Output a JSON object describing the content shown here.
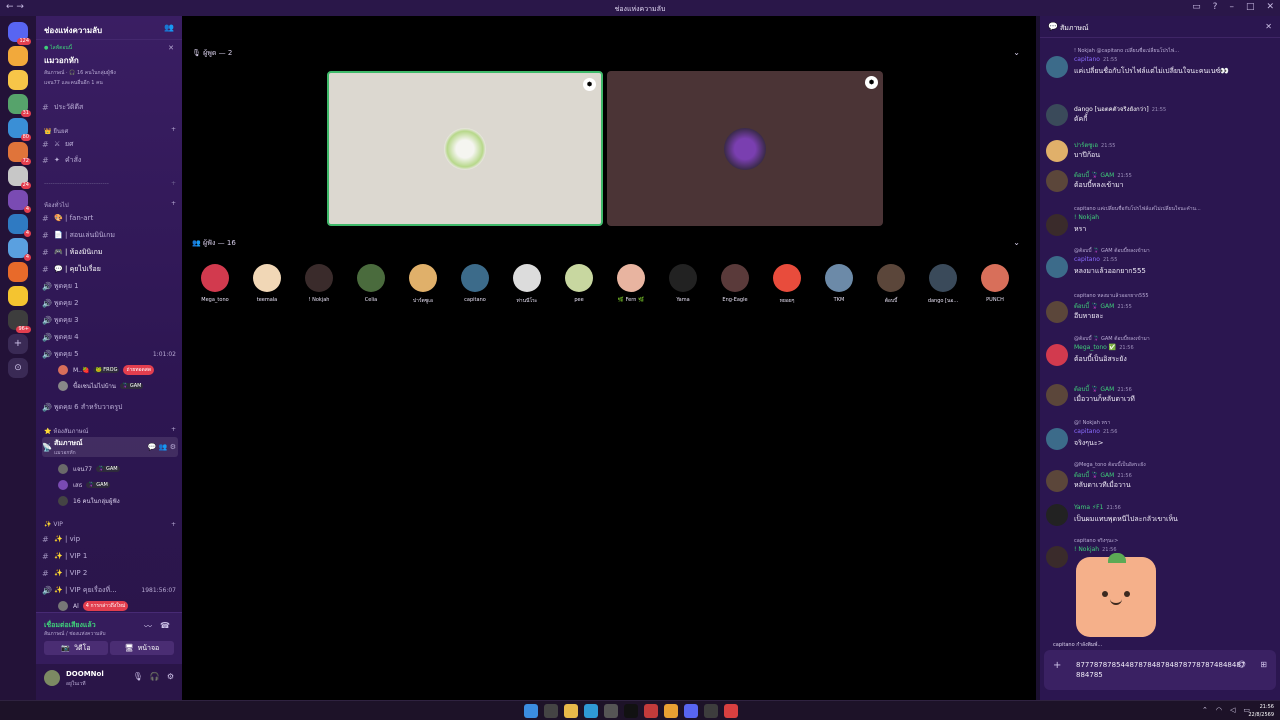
{
  "window": {
    "title": "ช่องแห่งความลับ"
  },
  "servers": [
    {
      "color": "#5865f2",
      "badge": "124"
    },
    {
      "color": "#f2a93b",
      "badge": ""
    },
    {
      "color": "#f7c548",
      "badge": ""
    },
    {
      "color": "#56a36b",
      "badge": "31"
    },
    {
      "color": "#3a8fd6",
      "badge": "80"
    },
    {
      "color": "#e0743a",
      "badge": "72"
    },
    {
      "color": "#c7c7c7",
      "badge": "24"
    },
    {
      "color": "#7a4bb3",
      "badge": "4"
    },
    {
      "color": "#2f7ac2",
      "badge": "4"
    },
    {
      "color": "#5aa0e0",
      "badge": "4"
    },
    {
      "color": "#e86a2a",
      "badge": ""
    },
    {
      "color": "#f4c430",
      "badge": ""
    },
    {
      "color": "#3d3d3d",
      "badge": "96+"
    }
  ],
  "sidebar": {
    "server_name": "ช่องแห่งความลับ",
    "event": {
      "live": "● ไลฟ์ตอนนี้",
      "title": "แมวอกหัก",
      "line1": "สัมภาษณ์ · 🎧 16 คนในกลุ่มผู้ฟัง",
      "line2": "แจน77 และคนอื่นอีก 1 คน"
    },
    "top_channels": [
      {
        "name": "ประวัติดีส",
        "emoji": ""
      },
      {
        "name": "ยศ",
        "emoji": "⚔"
      },
      {
        "name": "คำสั่ง",
        "emoji": "✦"
      }
    ],
    "cat_rank": "👑 ยืนยศ",
    "divider": "------------------------------",
    "cat_general": "ห้องทั่วไป",
    "general_channels": [
      {
        "name": "| fan-art",
        "emoji": "🎨"
      },
      {
        "name": "| สอนเล่นมินิเกม",
        "emoji": "📄"
      },
      {
        "name": "| ห้องมินิเกม",
        "emoji": "🎮"
      },
      {
        "name": "| คุยไปเรื่อย",
        "emoji": "💬"
      }
    ],
    "voice_channels": [
      "พูดคุย 1",
      "พูดคุย 2",
      "พูดคุย 3",
      "พูดคุย 4",
      "พูดคุย 5"
    ],
    "voice5_timer": "1:01:02",
    "voice5_users": [
      {
        "name": "M..🍓",
        "tag": "🐸 FROG",
        "red": "ถ่ายทอดสด"
      },
      {
        "name": "ขี้อเซนไม่ไปบ้าน",
        "tag": "🦹 GAM",
        "red": ""
      }
    ],
    "voice6": "พูดคุย 6 สำหรับวาดรูป",
    "cat_interview": "⭐ ห้องสัมภาษณ์",
    "stage_channel": {
      "name": "สัมภาษณ์",
      "sub": "แมวอกหัก"
    },
    "stage_users": [
      {
        "name": "แจน77",
        "tag": "🦹 GAM"
      },
      {
        "name": "เสธ",
        "tag": "🦹 GAM"
      },
      {
        "name": "16 คนในกลุ่มผู้ฟัง",
        "tag": ""
      }
    ],
    "cat_vip": "✨ VIP",
    "vip_channels": [
      {
        "name": "| vip",
        "emoji": "✨"
      },
      {
        "name": "| VIP 1",
        "emoji": "✨"
      },
      {
        "name": "| VIP 2",
        "emoji": "✨"
      },
      {
        "name": "| VIP คุยเรื่องที่...",
        "emoji": "✨",
        "tail": "1981:56:07"
      }
    ],
    "vip_user_preview": "Al",
    "mention_badge": "4 การกล่าวถึงใหม่",
    "connection": {
      "status": "เชื่อมต่อเสียงแล้ว",
      "sub": "สัมภาษณ์ / ช่องแห่งความลับ"
    },
    "video_label": "วิดีโอ",
    "screen_label": "หน้าจอ",
    "user": {
      "name": "DOOMNol",
      "status": "อยู่ในเวที"
    }
  },
  "stage": {
    "speakers_label": "ผู้พูด — 2",
    "audience_label": "ผู้ฟัง — 16",
    "audience": [
      {
        "name": "Mega_tono",
        "color": "#d23a4e"
      },
      {
        "name": "teemala",
        "color": "#f1d7b6"
      },
      {
        "name": "! Nokjah",
        "color": "#3a2b2b"
      },
      {
        "name": "Celia",
        "color": "#4a6b3d"
      },
      {
        "name": "ปาร์ตซูเอ",
        "color": "#e0b06a"
      },
      {
        "name": "capitano",
        "color": "#3c6b8a"
      },
      {
        "name": "ท่านนีโระ",
        "color": "#dcdcdc"
      },
      {
        "name": "pee",
        "color": "#c8d7a0"
      },
      {
        "name": "🌿 Fern 🌿",
        "color": "#e8b4a0"
      },
      {
        "name": "Yama",
        "color": "#222222"
      },
      {
        "name": "Eng-Eagle",
        "color": "#5a3a3a"
      },
      {
        "name": "หยอยๆ",
        "color": "#e84c3c"
      },
      {
        "name": "TKM",
        "color": "#6c8aa8"
      },
      {
        "name": "ต้อบบี้",
        "color": "#5b463a"
      },
      {
        "name": "dango [นอ...",
        "color": "#3a4a5a"
      },
      {
        "name": "PUNCH",
        "color": "#d86f5a"
      }
    ]
  },
  "chat": {
    "title": "สัมภาษณ์",
    "messages": [
      {
        "reply": "! Nokjah  @capitano เปลี่ยนชื่อเปลี่ยนโปรไฟ...",
        "author": "capitano",
        "author_color": "#8a6cff",
        "time": "21:55",
        "text": "แค่เปลี่ยนชื่อกับโปรไฟล์แต่ไม่เปลี่ยนใจนะคนเนซ์👀",
        "avatar": "#3c6b8a"
      },
      {
        "reply": "",
        "author": "dango [นอตคตัวจริงยังกว่า]",
        "author_color": "#ffffff",
        "time": "21:55",
        "text": "ดัคกี้",
        "avatar": "#3a4a5a"
      },
      {
        "reply": "",
        "author": "ปาร์ตซูเอ",
        "author_color": "#3fd17a",
        "time": "21:55",
        "text": "บาปีก้อน",
        "avatar": "#e0b06a"
      },
      {
        "reply": "",
        "author": "ต้อบบี้ 🦹 GAM",
        "author_color": "#3fd17a",
        "time": "21:55",
        "text": "ต้อบบี้หลงเข้ามา",
        "avatar": "#5b463a"
      },
      {
        "reply": "capitano แค่เปลี่ยนชื่อกับโปรไฟล์แต่ไม่เปลี่ยนใจนะคำน...",
        "author": "! Nokjah",
        "author_color": "#3fd17a",
        "time": "",
        "text": "หรา",
        "avatar": "#3a2b2b"
      },
      {
        "reply": "@ต้อบบี้ 🦹 GAM ต้อบบี้หลงเข้ามา",
        "author": "capitano",
        "author_color": "#8a6cff",
        "time": "21:55",
        "text": "หลงมาแล้วออกยาก555",
        "avatar": "#3c6b8a"
      },
      {
        "reply": "capitano หลงมาแล้วออกยาก555",
        "author": "ต้อบบี้ 🦹 GAM",
        "author_color": "#3fd17a",
        "time": "21:55",
        "text": "อีบหายละ",
        "avatar": "#5b463a"
      },
      {
        "reply": "@ต้อบบี้ 🦹 GAM ต้อบบี้หลงเข้ามา",
        "author": "Mega_tono ✅",
        "author_color": "#3fd17a",
        "time": "21:56",
        "text": "ต้อบบี้เป็นอิสระยัง",
        "avatar": "#d23a4e"
      },
      {
        "reply": "",
        "author": "ต้อบบี้ 🦹 GAM",
        "author_color": "#3fd17a",
        "time": "21:56",
        "text": "เมื่อวานก็หลับดาเวที",
        "avatar": "#5b463a"
      },
      {
        "reply": "@! Nokjah  หรา",
        "author": "capitano",
        "author_color": "#8a6cff",
        "time": "21:56",
        "text": "จริงๆนะ>",
        "avatar": "#3c6b8a"
      },
      {
        "reply": "@Mega_tono ต้อบบี้เป็นอิสระยัง",
        "author": "ต้อบบี้ 🦹 GAM",
        "author_color": "#3fd17a",
        "time": "21:56",
        "text": "หลับดาเวทีเมื่อวาน",
        "avatar": "#5b463a"
      },
      {
        "reply": "",
        "author": "Yama ⚡F1",
        "author_color": "#3fd17a",
        "time": "21:56",
        "text": "เป็นผมแทบพุดหนีไปละกลัวเขาเห็น",
        "avatar": "#222222"
      },
      {
        "reply": "capitano จริงๆนะ>",
        "author": "! Nokjah",
        "author_color": "#3fd17a",
        "time": "21:56",
        "text": "",
        "avatar": "#3a2b2b"
      }
    ],
    "typing": "capitano กำลังพิมพ์...",
    "input_value": "87778787854487878487848787787874848487884785"
  },
  "taskbar": {
    "clock_time": "21:56",
    "clock_date": "22/8/2569"
  }
}
